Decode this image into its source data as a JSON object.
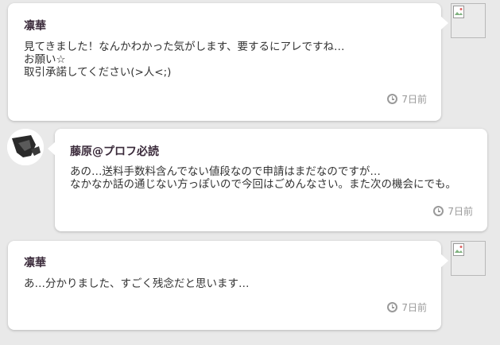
{
  "messages": [
    {
      "sender": "凛華",
      "lines": [
        "見てきました！なんかわかった気がします、要するにアレですね…",
        "お願い☆",
        "取引承諾してください(>人<;)"
      ],
      "time": "7日前"
    },
    {
      "sender": "藤原@プロフ必読",
      "lines": [
        "あの…送料手数料含んでない値段なので申請はまだなのですが…",
        "なかなか話の通じない方っぽいので今回はごめんなさい。また次の機会にでも。"
      ],
      "time": "7日前"
    },
    {
      "sender": "凛華",
      "lines": [
        "あ…分かりました、すごく残念だと思います…"
      ],
      "time": "7日前"
    }
  ]
}
